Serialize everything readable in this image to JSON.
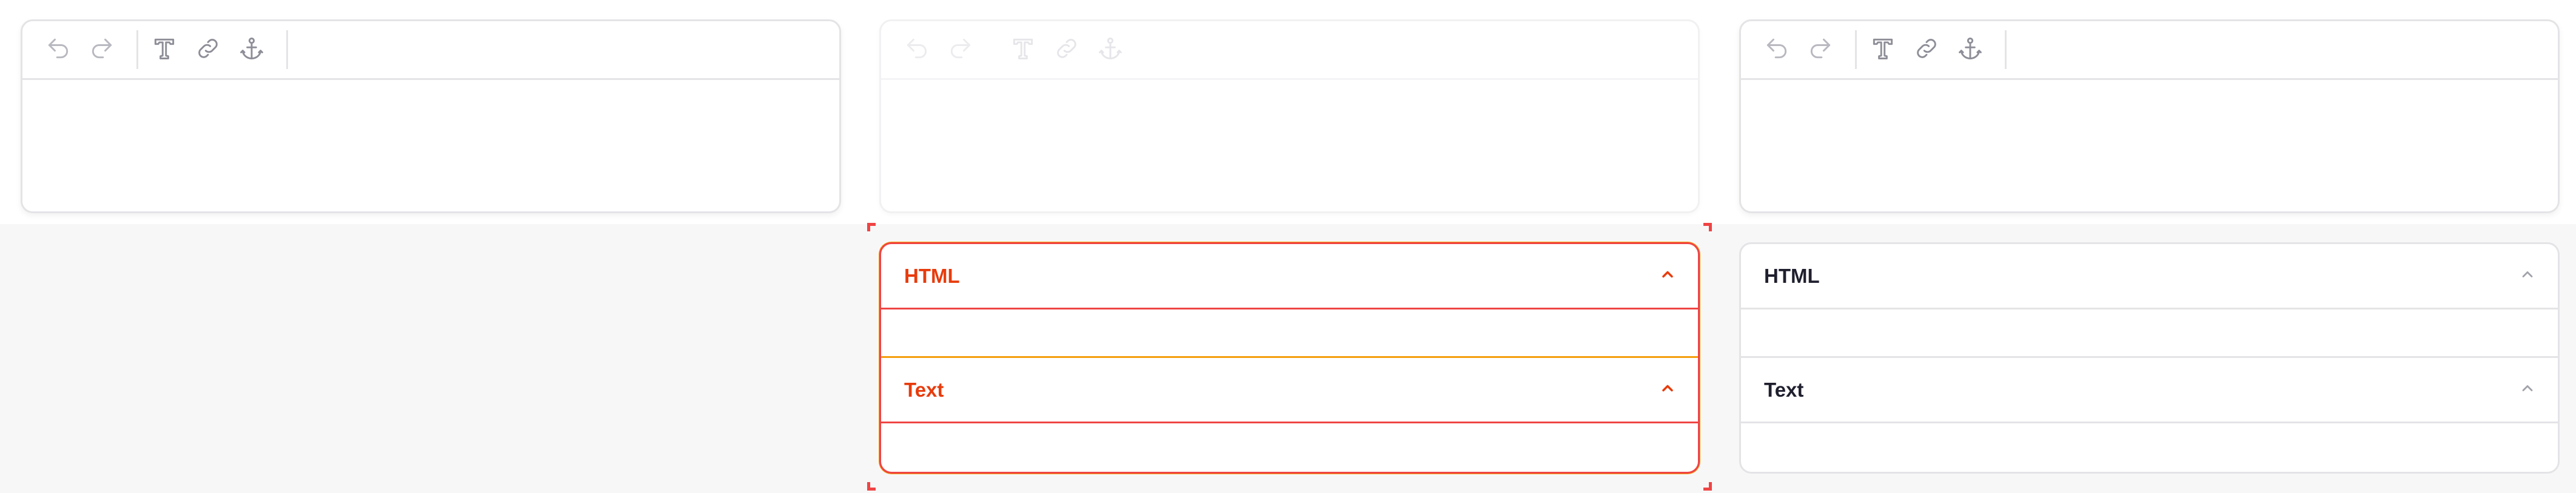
{
  "colors": {
    "border": "#e4e4e7",
    "icon": "#9ca3af",
    "icon_faded": "#e5e7eb",
    "active_border": "#ef4444",
    "active_accent": "#f59e0b",
    "active_text": "#e83b0c",
    "title_text": "#1f1f2e",
    "chevron": "#a1a1aa"
  },
  "toolbar": {
    "buttons": [
      {
        "icon": "undo-icon"
      },
      {
        "icon": "redo-icon"
      },
      {
        "icon": "text-format-icon"
      },
      {
        "icon": "link-icon"
      },
      {
        "icon": "anchor-icon"
      }
    ]
  },
  "accordion": {
    "sections": [
      {
        "title": "HTML",
        "expanded": true
      },
      {
        "title": "Text",
        "expanded": true
      }
    ]
  }
}
